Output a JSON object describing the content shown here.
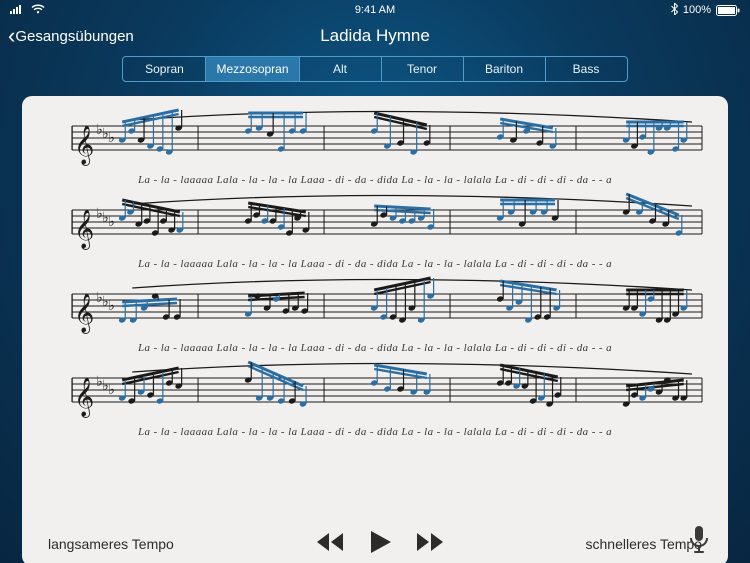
{
  "status": {
    "time": "9:41 AM",
    "battery": "100%"
  },
  "nav": {
    "back_label": "Gesangsübungen",
    "title": "Ladida Hymne"
  },
  "voices": {
    "items": [
      "Sopran",
      "Mezzosopran",
      "Alt",
      "Tenor",
      "Bariton",
      "Bass"
    ],
    "active_index": 1
  },
  "score": {
    "lines": [
      {
        "lyric": "La - la - laaaaa   Lala - la - la - la   Laaa - di - da - dida   La - la - la - lalala   La - di - di - di - da - - a"
      },
      {
        "lyric": "La - la - laaaaa   Lala - la - la - la   Laaa - di - da - dida   La - la - la - lalala   La - di - di - di - da - - a"
      },
      {
        "lyric": "La - la - laaaaa   Lala - la - la - la   Laaa - di - da - dida   La - la - la - lalala   La - di - di - di - da - - a"
      },
      {
        "lyric": "La - la - laaaaa   Lala - la - la - la   Laaa - di - da - dida   La - la - la - lalala   La - di - di - di - da - - a"
      }
    ]
  },
  "controls": {
    "slower_label": "langsameres Tempo",
    "faster_label": "schnelleres Tempo"
  },
  "colors": {
    "accent": "#2a77a9",
    "note_blue": "#2a6ea3",
    "note_black": "#1a1a1a"
  }
}
